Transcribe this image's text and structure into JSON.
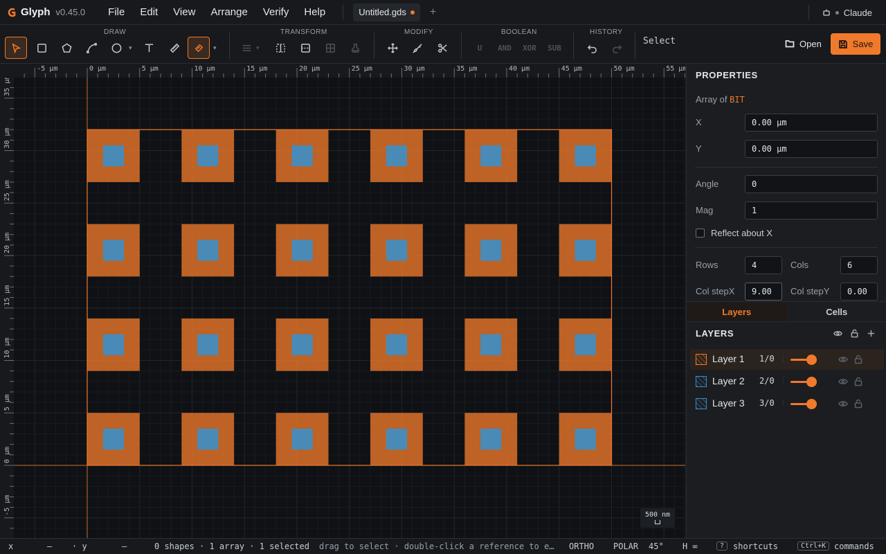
{
  "app": {
    "name": "Glyph",
    "version": "v0.45.0"
  },
  "menu": [
    "File",
    "Edit",
    "View",
    "Arrange",
    "Verify",
    "Help"
  ],
  "tab": {
    "title": "Untitled.gds"
  },
  "user": {
    "name": "Claude"
  },
  "toolbar": {
    "groups": {
      "draw": "DRAW",
      "transform": "TRANSFORM",
      "modify": "MODIFY",
      "boolean": "BOOLEAN",
      "history": "HISTORY"
    },
    "boolean_ops": [
      "U",
      "AND",
      "XOR",
      "SUB"
    ],
    "mode": "Select",
    "open_label": "Open",
    "save_label": "Save",
    "accent": "#f07a2b"
  },
  "ruler": {
    "x_ticks": [
      "-5 µm",
      "0 µm",
      "5 µm",
      "10 µm",
      "15 µm",
      "20 µm",
      "25 µm",
      "30 µm",
      "35 µm",
      "40 µm",
      "45 µm",
      "50 µm",
      "55 µm"
    ],
    "y_ticks": [
      "35 µm",
      "30 µm",
      "25 µm",
      "20 µm",
      "15 µm",
      "10 µm",
      "5 µm",
      "0 µm",
      "-5 µm"
    ]
  },
  "scale_bar": {
    "label": "500 nm"
  },
  "properties": {
    "title": "PROPERTIES",
    "array_prefix": "Array of",
    "cell_name": "BIT",
    "x_label": "X",
    "x_value": "0.00 µm",
    "y_label": "Y",
    "y_value": "0.00 µm",
    "angle_label": "Angle",
    "angle_value": "0",
    "mag_label": "Mag",
    "mag_value": "1",
    "reflect_label": "Reflect about X",
    "rows_label": "Rows",
    "rows_value": "4",
    "cols_label": "Cols",
    "cols_value": "6",
    "colstepx_label": "Col stepX",
    "colstepx_value": "9.00",
    "colstepy_label": "Col stepY",
    "colstepy_value": "0.00"
  },
  "panel_tabs": {
    "layers": "Layers",
    "cells": "Cells"
  },
  "layers": {
    "title": "LAYERS",
    "items": [
      {
        "name": "Layer 1",
        "num": "1/0",
        "color": "#f07a2b",
        "opacity": 0.8
      },
      {
        "name": "Layer 2",
        "num": "2/0",
        "color": "#3d8fc6",
        "opacity": 0.8
      },
      {
        "name": "Layer 3",
        "num": "3/0",
        "color": "#3d8fc6",
        "opacity": 0.8
      }
    ]
  },
  "status": {
    "x_label": "x",
    "x_value": "—",
    "y_label": "· y",
    "y_value": "—",
    "summary": "0 shapes · 1 array · 1 selected",
    "hint": "drag to select · double-click a reference to e…",
    "ortho": "ORTHO",
    "polar": "POLAR",
    "polar_angle": "45°",
    "h": "H ∞",
    "shortcuts_key": "?",
    "shortcuts_label": "shortcuts",
    "commands_key": "Ctrl+K",
    "commands_label": "commands"
  }
}
